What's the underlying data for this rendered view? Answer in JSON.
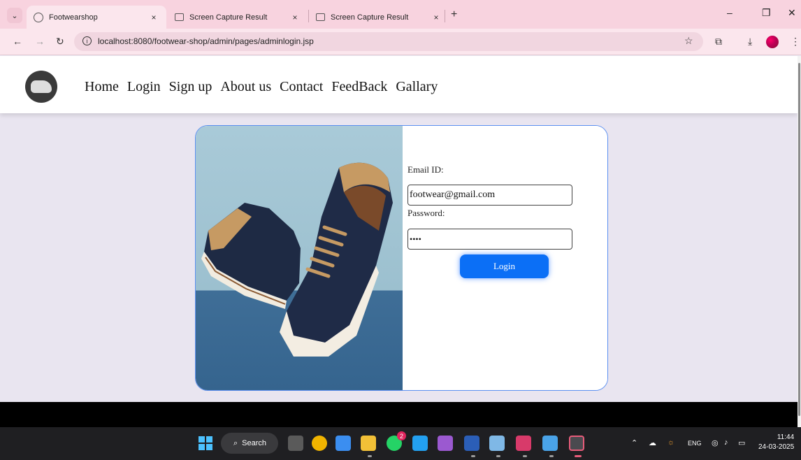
{
  "browser": {
    "tabs": [
      {
        "title": "Footwearshop",
        "active": true
      },
      {
        "title": "Screen Capture Result",
        "active": false
      },
      {
        "title": "Screen Capture Result",
        "active": false
      }
    ],
    "tab_close_glyph": "×",
    "new_tab_glyph": "+",
    "url": "localhost:8080/footwear-shop/admin/pages/adminlogin.jsp"
  },
  "nav": {
    "items": [
      "Home",
      "Login",
      "Sign up",
      "About us",
      "Contact",
      "FeedBack",
      "Gallary"
    ]
  },
  "login_form": {
    "email_label": "Email ID:",
    "email_value": "footwear@gmail.com",
    "password_label": "Password:",
    "password_value": "••••",
    "submit_label": "Login"
  },
  "taskbar": {
    "search_label": "Search",
    "whatsapp_badge": "2",
    "language": "ENG",
    "time": "11:44",
    "date": "24-03-2025"
  },
  "colors": {
    "tab_strip": "#f8d3df",
    "page_bg": "#e9e5f0",
    "card_border": "#5b8ff0",
    "login_button": "#0b6ff6",
    "taskbar": "#1f1f22"
  }
}
